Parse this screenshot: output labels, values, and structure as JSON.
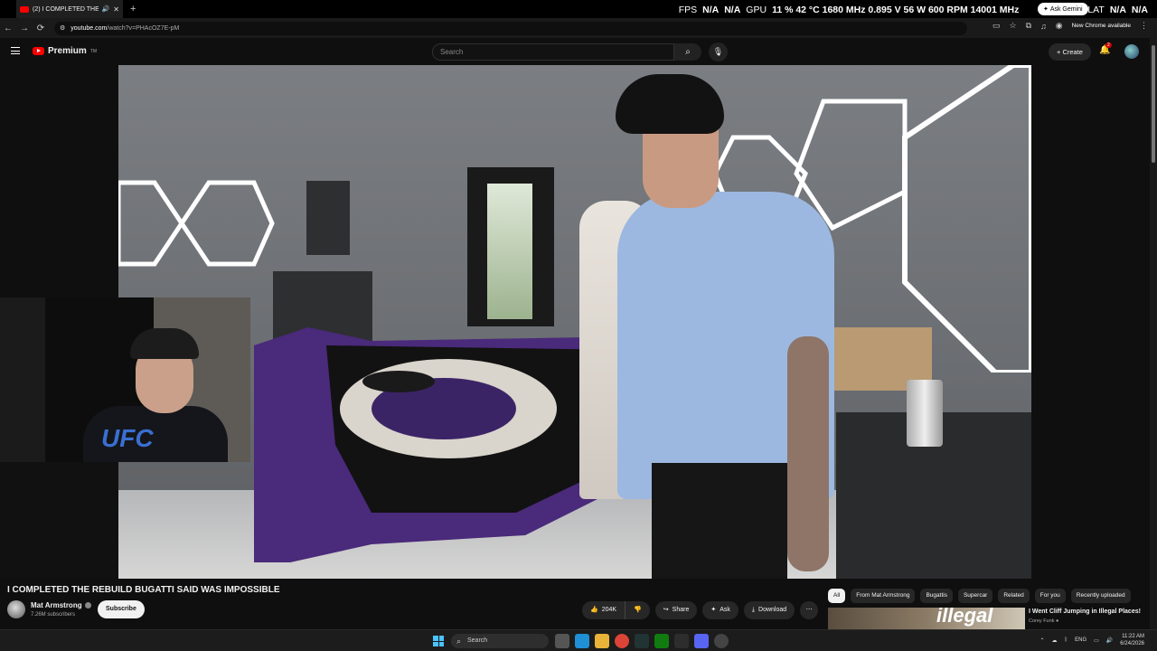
{
  "browser": {
    "tab_title": "(2) I COMPLETED THE REBUIL",
    "tab_audio_icon": "speaker-icon",
    "url_host": "youtube.com",
    "url_path": "/watch?v=PHAcOZ7E-pM",
    "ask_gemini": "Ask Gemini",
    "new_chrome": "New Chrome available"
  },
  "overlay": {
    "fps_label": "FPS",
    "fps_value": "N/A",
    "fps_value2": "N/A",
    "gpu_label": "GPU",
    "gpu_stats": "11 %  42 °C  1680 MHz  0.895 V  56 W  600 RPM  14001 MHz",
    "lat_label": "LAT",
    "lat_value": "N/A",
    "lat_value2": "N/A"
  },
  "youtube": {
    "logo_text": "Premium",
    "logo_tm": "TM",
    "search_placeholder": "Search",
    "create_label": "Create",
    "notif_count": "2"
  },
  "video": {
    "title": "I COMPLETED THE REBUILD BUGATTI SAID WAS IMPOSSIBLE",
    "channel": "Mat Armstrong",
    "subscribers": "7.26M subscribers",
    "subscribe_label": "Subscribe",
    "likes": "204K",
    "share_label": "Share",
    "ask_label": "Ask",
    "download_label": "Download"
  },
  "chips": [
    "All",
    "From Mat Armstrong",
    "Bugattis",
    "Supercar",
    "Related",
    "For you",
    "Recently uploaded"
  ],
  "recommended": {
    "title": "I Went Cliff Jumping in Illegal Places!",
    "channel": "Corey Funk",
    "thumb_text": "illegal"
  },
  "taskbar": {
    "search_placeholder": "Search",
    "lang": "ENG",
    "time": "11:22 AM",
    "date": "6/24/2026"
  },
  "colors": {
    "yt_red": "#ff0000",
    "bg": "#0f0f0f",
    "pill": "#272727"
  }
}
